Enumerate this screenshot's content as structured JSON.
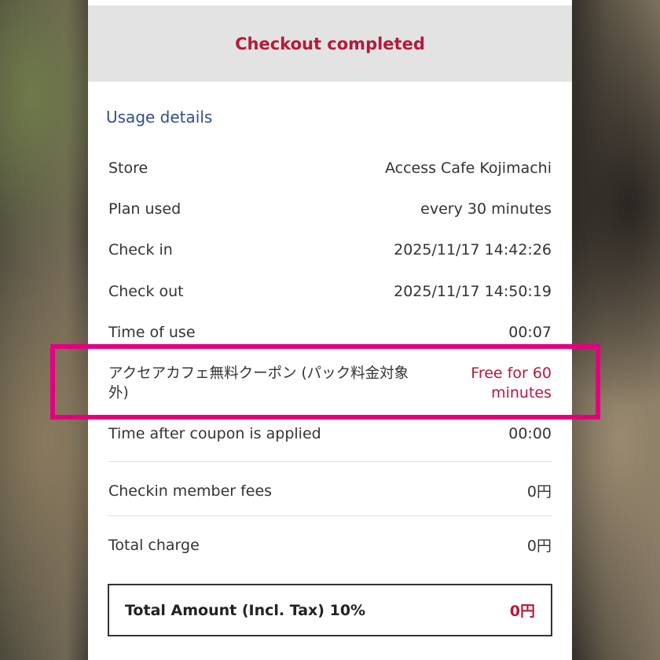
{
  "header": {
    "title": "Checkout completed"
  },
  "section": {
    "title": "Usage details"
  },
  "details": [
    {
      "label": "Store",
      "value": "Access Cafe Kojimachi"
    },
    {
      "label": "Plan used",
      "value": "every 30 minutes"
    },
    {
      "label": "Check in",
      "value": "2025/11/17 14:42:26"
    },
    {
      "label": "Check out",
      "value": "2025/11/17 14:50:19"
    },
    {
      "label": "Time of use",
      "value": "00:07"
    }
  ],
  "coupon": {
    "label": "アクセアカフェ無料クーポン (パック料金対象外)",
    "value": "Free for 60 minutes"
  },
  "after_coupon": {
    "label": "Time after coupon is applied",
    "value": "00:00"
  },
  "member_fees": {
    "label": "Checkin member fees",
    "value": "0円"
  },
  "total_charge": {
    "label": "Total charge",
    "value": "0円"
  },
  "total_amount": {
    "label": "Total Amount (Incl. Tax) 10%",
    "value": "0円"
  },
  "colors": {
    "accent": "#b5193c",
    "link": "#2f4f8a",
    "highlight": "#e3007e"
  }
}
